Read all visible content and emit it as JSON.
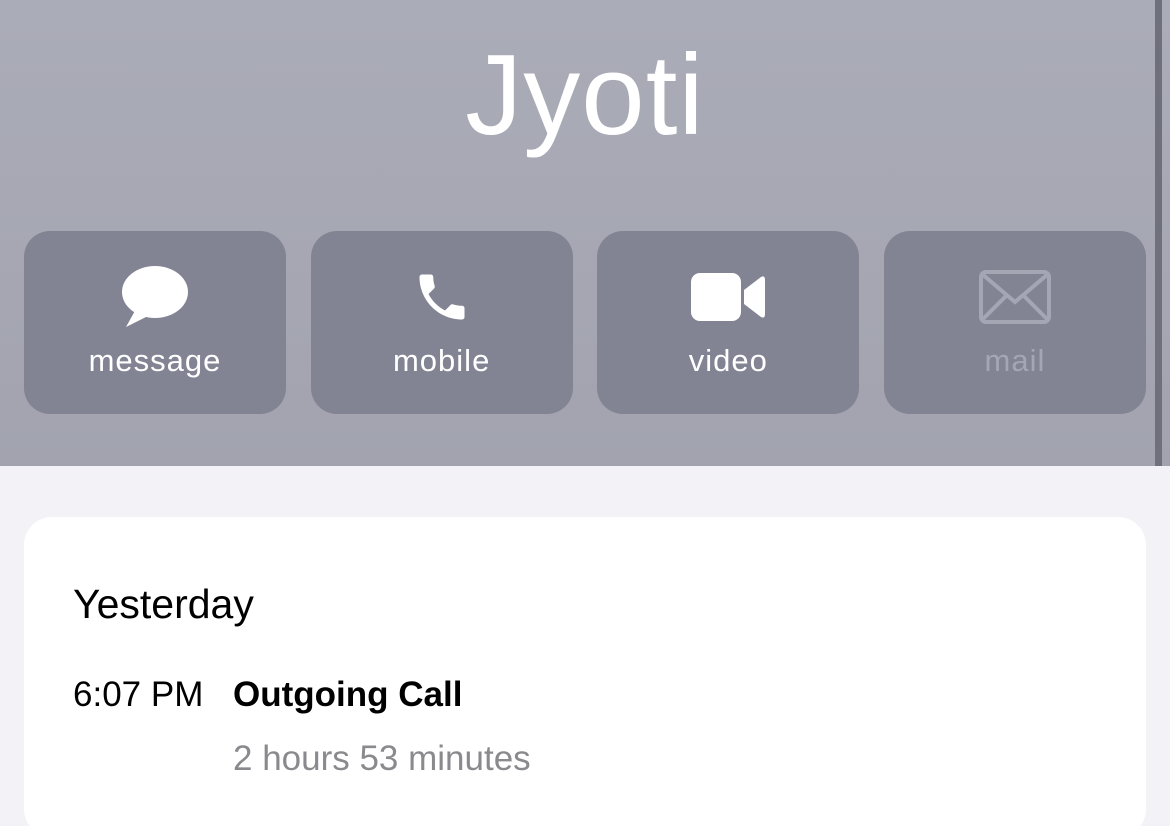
{
  "contact": {
    "name": "Jyoti"
  },
  "actions": [
    {
      "label": "message",
      "icon": "speech-bubble-icon",
      "enabled": true
    },
    {
      "label": "mobile",
      "icon": "phone-icon",
      "enabled": true
    },
    {
      "label": "video",
      "icon": "video-camera-icon",
      "enabled": true
    },
    {
      "label": "mail",
      "icon": "envelope-icon",
      "enabled": false
    }
  ],
  "call_history": {
    "day": "Yesterday",
    "entries": [
      {
        "time": "6:07 PM",
        "type": "Outgoing Call",
        "duration": "2 hours 53 minutes"
      }
    ]
  },
  "colors": {
    "header_background": "#a6a7b3",
    "button_background": "#828494",
    "disabled_label": "#a4a6b3",
    "page_background": "#f2f2f7",
    "secondary_text": "#8a8a8e"
  }
}
